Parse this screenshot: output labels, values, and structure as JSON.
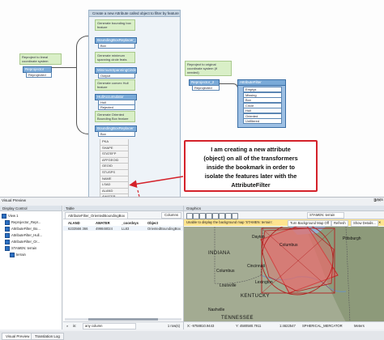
{
  "canvas": {
    "bookmark_title": "Create a new Attribute called object to filter by feature",
    "left_annotation": "Reproject to lineal coordinate system",
    "left_reprojector": {
      "title": "Reprojector",
      "port": "Reprojected"
    },
    "annotations": [
      "Generate bounding box feature",
      "Generate minimum spanning circle feats",
      "Generate convex Hull feature",
      "Generate Oriented Bounding Box feature"
    ],
    "transformers": [
      {
        "title": "BoundingBoxReplacer_2",
        "ports": [
          "Box"
        ]
      },
      {
        "title": "MinimumSpanningCircleReplacer",
        "ports": [
          "Output"
        ]
      },
      {
        "title": "HullAccumulator",
        "ports": [
          "Hull",
          "Rejected"
        ]
      },
      {
        "title": "BoundingBoxReplacer",
        "ports": [
          "Box"
        ]
      }
    ],
    "attributes": [
      "PKA",
      "SHAPE",
      "STATEFP",
      "AFFGEOID",
      "GEOID",
      "STUSPS",
      "NAME",
      "LSAD",
      "ALAND",
      "AWATER",
      "_coordsys",
      "Object"
    ],
    "right_annotation": "Reproject to original coordinate system (if needed)",
    "right_reprojector": {
      "title": "Reprojector_2",
      "port": "Reprojected"
    },
    "filter": {
      "title": "AttributeFilter",
      "ports": [
        "Emptys",
        "Missing",
        "Box",
        "Circle",
        "Hull",
        "Oriented",
        "Unfiltered"
      ]
    }
  },
  "callout": {
    "lines": [
      "I am creating a new attribute",
      "(object) on all of the transformers",
      "inside the bookmark in order to",
      "isolate the features later with the",
      "AttributeFilter"
    ]
  },
  "preview": {
    "title": "Visual Preview",
    "display_control": {
      "title": "Display Control",
      "items": [
        "View 1",
        "Reprojector_Repr...",
        "AttributeFilter_Bo...",
        "AttributeFilter_Hull...",
        "AttributeFilter_Or...",
        "STAMEN: terrain",
        "terrain"
      ]
    },
    "table": {
      "title": "Table",
      "tab": "AttributeFilter_OrientedBoundingBox",
      "columns_button": "Columns",
      "headers": [
        "ALAND",
        "AWATER",
        "_coordsys",
        "Object"
      ],
      "row": [
        "6233566 366",
        "499848024",
        "LL83",
        "OrientedBoundingBox"
      ],
      "search_placeholder": "any column",
      "count": "1 row(s)"
    },
    "graphics": {
      "title": "Graphics",
      "basemap_select": "STAMEN: terrain",
      "warning": "Unable to display the background map 'STAMEN: terrain'.",
      "turn_off": "Turn Background Map Off",
      "refresh": "Refresh",
      "show_details": "Show Details...",
      "map_labels": {
        "indiana": "INDIANA",
        "kentucky": "KENTUCKY",
        "tennessee": "TENNESSEE",
        "columbus_oh": "Columbus",
        "columbus_in": "Columbus",
        "cincinnati": "Cincinnati",
        "louisville": "Louisville",
        "lexington": "Lexington",
        "pittsburgh": "Pittsburgh",
        "nashville": "Nashville",
        "dayton": "Dayton"
      },
      "coords": {
        "x": "X: -9758810.9443",
        "y": "Y: 4580580.7911",
        "scale": "1:4622547",
        "projection": "SPHERICAL_MERCATOR",
        "units": "Meters"
      }
    },
    "bottom_tabs": [
      "Visual Preview",
      "Translation Log"
    ],
    "side_label": "Units"
  },
  "colors": {
    "callout_border": "#d4222a",
    "transformer": "#7aaad8",
    "annotation": "#d9efc7",
    "ohio_fill": "#e86b6b"
  }
}
